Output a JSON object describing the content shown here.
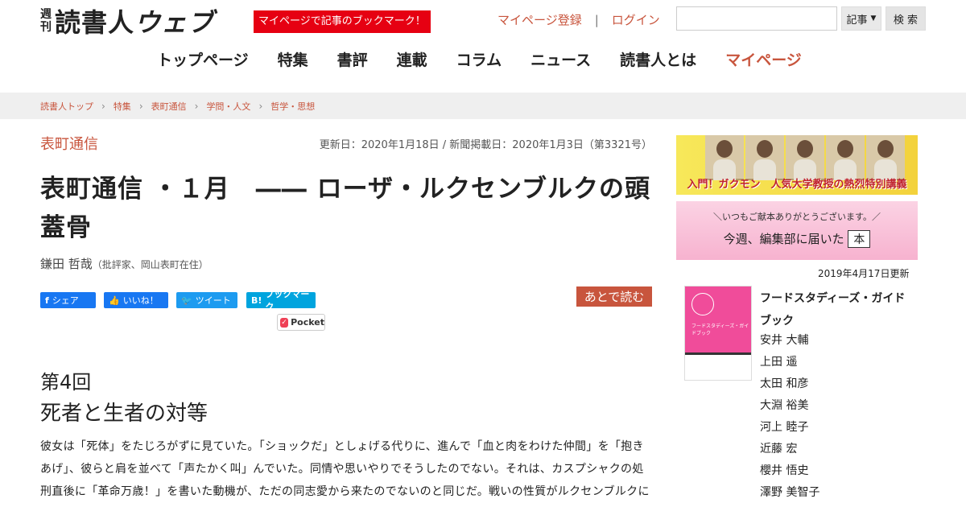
{
  "header": {
    "logo_weekly_1": "週",
    "logo_weekly_2": "刊",
    "logo_brand": "読書人",
    "logo_web": "ウェブ",
    "bookmark_banner": "マイページで記事のブックマーク！",
    "register_link": "マイページ登録",
    "separator": "|",
    "login_link": "ログイン",
    "search_value": "",
    "search_scope": "記事",
    "search_button": "検 索"
  },
  "nav": [
    "トップページ",
    "特集",
    "書評",
    "連載",
    "コラム",
    "ニュース",
    "読書人とは",
    "マイページ"
  ],
  "breadcrumb": [
    "読書人トップ",
    "特集",
    "表町通信",
    "学問・人文",
    "哲学・思想"
  ],
  "article": {
    "category": "表町通信",
    "dates": "更新日：2020年1月18日 / 新聞掲載日：2020年1月3日（第3321号）",
    "title": "表町通信 ・１月　―― ローザ・ルクセンブルクの頭蓋骨",
    "author_name": "鎌田 哲哉",
    "author_note": "（批評家、岡山表町在住）",
    "share_fb": "シェア",
    "share_like": "いいね！",
    "share_tw": "ツイート",
    "share_hb": "ブックマーク",
    "read_later": "あとで読む",
    "pocket": "Pocket",
    "episode": "第4回",
    "subtitle": "死者と生者の対等",
    "body": "彼女は「死体」をたじろがずに見ていた。「ショックだ」としょげる代りに、進んで「血と肉をわけた仲間」を「抱きあげ」、彼らと肩を並べて「声たかく叫」んでいた。同情や思いやりでそうしたのでない。それは、カスプシャクの処刑直後に「革命万歳！」を書いた動機が、ただの同志愛から来たのでないのと同じだ。戦いの性質がルクセンブルクにそれを強いる。"
  },
  "sidebar": {
    "ad1_caption": "入門！ガクモン　人気大学教授の熱烈特別講義",
    "ad2_line1": "＼いつもご献本ありがとうございます。／",
    "ad2_line2": "今週、編集部に届いた",
    "ad2_book": "本",
    "updated": "2019年4月17日更新",
    "book_cover_title": "フードスタディーズ・ガイドブック",
    "book_title": "フードスタディーズ・ガイドブック",
    "authors": [
      "安井 大輔",
      "上田 遥",
      "太田 和彦",
      "大淵 裕美",
      "河上 睦子",
      "近藤 宏",
      "櫻井 悟史",
      "澤野 美智子"
    ]
  },
  "colors": {
    "accent": "#c8553d",
    "banner_red": "#e60012",
    "facebook": "#1877f2",
    "twitter": "#1d9bf0",
    "hatena": "#00a4de"
  }
}
